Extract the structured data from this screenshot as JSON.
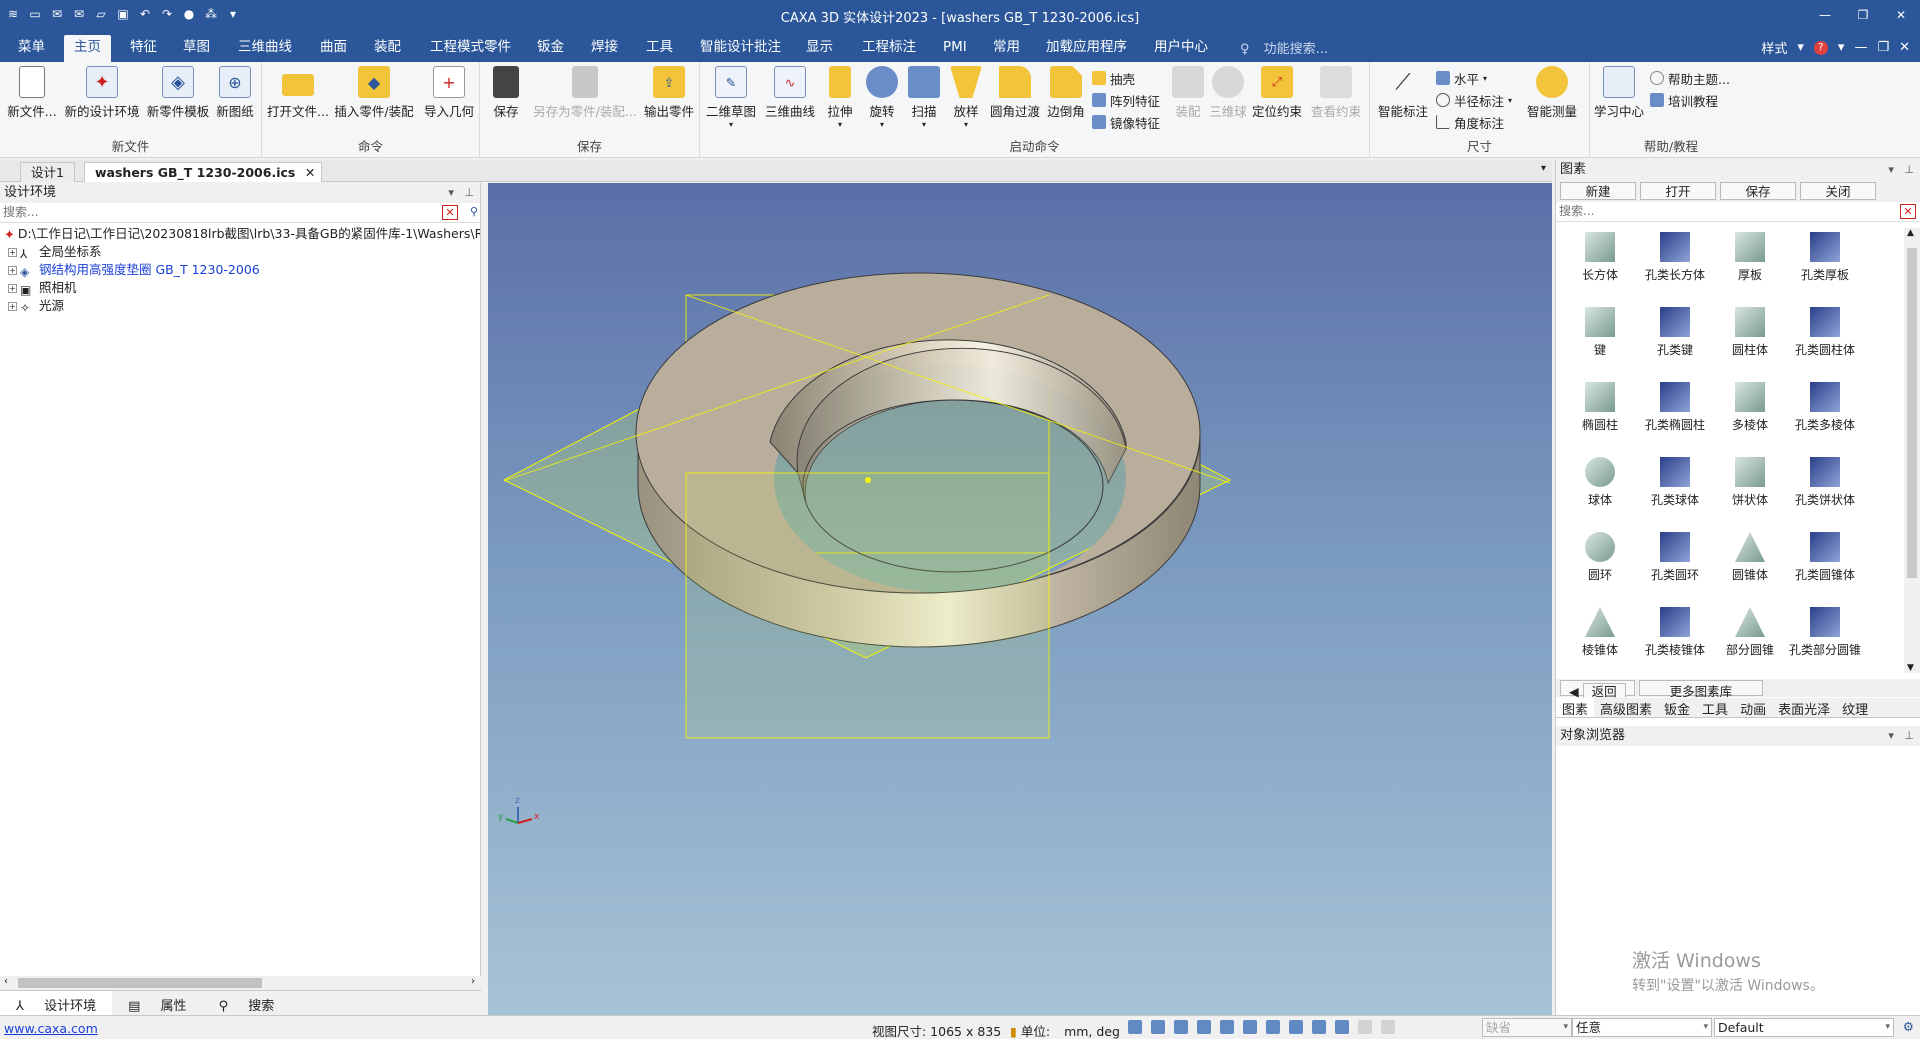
{
  "window": {
    "title": "CAXA 3D 实体设计2023 - [washers GB_T 1230-2006.ics]"
  },
  "menu": {
    "tabs": [
      "菜单",
      "主页",
      "特征",
      "草图",
      "三维曲线",
      "曲面",
      "装配",
      "工程模式零件",
      "钣金",
      "焊接",
      "工具",
      "智能设计批注",
      "显示",
      "工程标注",
      "PMI",
      "常用",
      "加载应用程序",
      "用户中心"
    ],
    "active": "主页",
    "search_placeholder": "功能搜索...",
    "style_label": "样式"
  },
  "ribbon": {
    "groups": {
      "new_file": "新文件",
      "command": "命令",
      "save": "保存",
      "launch": "启动命令",
      "dimension": "尺寸",
      "help": "帮助/教程"
    },
    "buttons": {
      "new_file": "新文件...",
      "new_env": "新的设计环境",
      "new_template": "新零件模板",
      "new_drawing": "新图纸",
      "open_file": "打开文件...",
      "insert_part": "插入零件/装配",
      "import_geom": "导入几何",
      "save": "保存",
      "save_as": "另存为零件/装配...",
      "export_part": "输出零件",
      "sketch2d": "二维草图",
      "curve3d": "三维曲线",
      "extrude": "拉伸",
      "revolve": "旋转",
      "sweep": "扫描",
      "loft": "放样",
      "fillet": "圆角过渡",
      "chamfer": "边倒角",
      "shell": "抽壳",
      "pattern": "阵列特征",
      "mirror": "镜像特征",
      "assembly": "装配",
      "ball3d": "三维球",
      "locate": "定位约束",
      "view_constraint": "查看约束",
      "smart_dim": "智能标注",
      "horizontal": "水平",
      "radius": "半径标注",
      "angle": "角度标注",
      "smart_measure": "智能测量",
      "learn": "学习中心",
      "help_topic": "帮助主题...",
      "training": "培训教程"
    }
  },
  "doctabs": [
    "设计1",
    "washers GB_T 1230-2006.ics"
  ],
  "leftpanel": {
    "title": "设计环境",
    "search_placeholder": "搜索...",
    "tree": [
      {
        "label": "D:\\工作日记\\工作日记\\20230818lrb截图\\lrb\\33-具备GB的紧固件库-1\\Washers\\Ro",
        "link": false
      },
      {
        "label": "全局坐标系",
        "link": false
      },
      {
        "label": "钢结构用高强度垫圈 GB_T 1230-2006",
        "link": true
      },
      {
        "label": "照相机",
        "link": false
      },
      {
        "label": "光源",
        "link": false
      }
    ],
    "bottom_tabs": [
      "设计环境",
      "属性",
      "搜索"
    ]
  },
  "rightpanel": {
    "title": "图素",
    "toolbar": [
      "新建",
      "打开",
      "保存",
      "关闭"
    ],
    "search_placeholder": "搜索...",
    "shapes": [
      "长方体",
      "孔类长方体",
      "厚板",
      "孔类厚板",
      "键",
      "孔类键",
      "圆柱体",
      "孔类圆柱体",
      "椭圆柱",
      "孔类椭圆柱",
      "多棱体",
      "孔类多棱体",
      "球体",
      "孔类球体",
      "饼状体",
      "孔类饼状体",
      "圆环",
      "孔类圆环",
      "圆锥体",
      "孔类圆锥体",
      "棱锥体",
      "孔类棱锥体",
      "部分圆锥",
      "孔类部分圆锥"
    ],
    "nav": [
      "返回",
      "更多图素库"
    ],
    "tabs": [
      "图素",
      "高级图素",
      "钣金",
      "工具",
      "动画",
      "表面光泽",
      "纹理"
    ],
    "object_browser": "对象浏览器",
    "watermark_1": "激活 Windows",
    "watermark_2": "转到\"设置\"以激活 Windows。"
  },
  "statusbar": {
    "link": "www.caxa.com",
    "view_size": "视图尺寸: 1065 x  835",
    "unit_label": "单位:",
    "unit_value": "mm, deg",
    "select1": "缺省",
    "select2": "任意",
    "select3": "Default"
  },
  "colors": {
    "brand": "#2b579a",
    "washer": "#b9ae9c",
    "selection": "#f5f500"
  }
}
